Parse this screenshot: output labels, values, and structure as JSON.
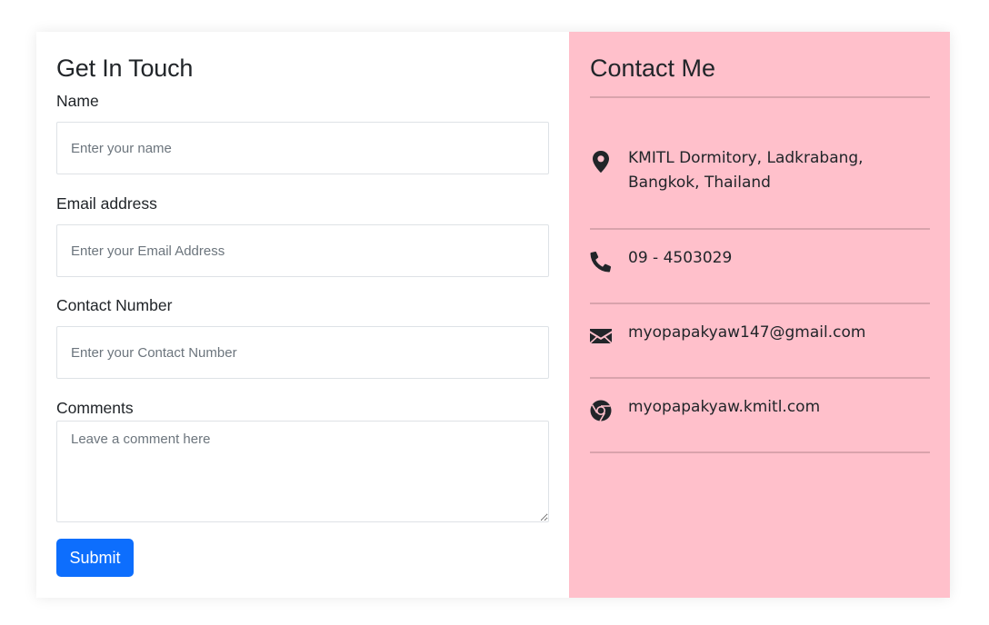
{
  "form": {
    "title": "Get In Touch",
    "name_label": "Name",
    "name_placeholder": "Enter your name",
    "email_label": "Email address",
    "email_placeholder": "Enter your Email Address",
    "contact_label": "Contact Number",
    "contact_placeholder": "Enter your Contact Number",
    "comments_label": "Comments",
    "comments_placeholder": "Leave a comment here",
    "submit_label": "Submit"
  },
  "contact": {
    "title": "Contact Me",
    "items": [
      {
        "icon": "map-marker-icon",
        "text": "KMITL Dormitory, Ladkrabang, Bangkok, Thailand"
      },
      {
        "icon": "phone-icon",
        "text": "09 - 4503029"
      },
      {
        "icon": "envelope-icon",
        "text": "myopapakyaw147@gmail.com"
      },
      {
        "icon": "chrome-icon",
        "text": "myopapakyaw.kmitl.com"
      }
    ]
  },
  "colors": {
    "panel_bg": "#ffc0cb",
    "button_bg": "#0d6efd",
    "icon_color": "#212529"
  }
}
